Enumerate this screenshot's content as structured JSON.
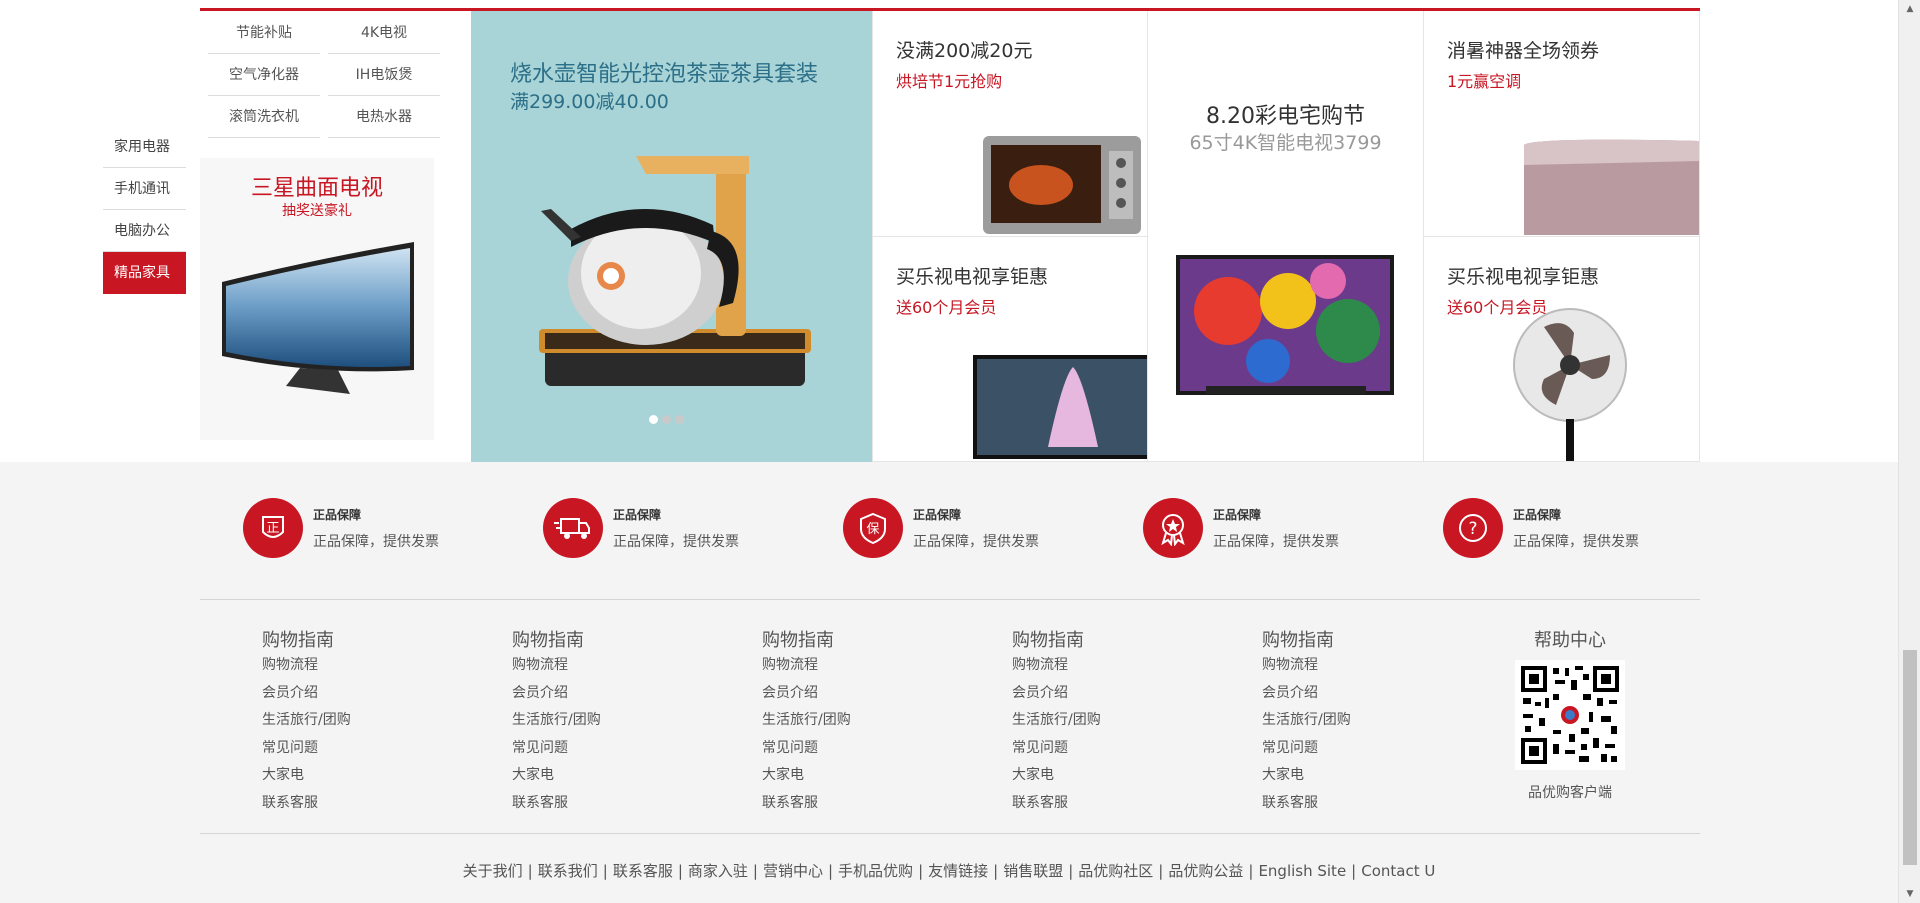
{
  "floor_tabs": [
    "家用电器",
    "手机通讯",
    "电脑办公",
    "精品家具"
  ],
  "categories": [
    "节能补贴",
    "4K电视",
    "空气净化器",
    "IH电饭煲",
    "滚筒洗衣机",
    "电热水器"
  ],
  "promo_tv": {
    "title": "三星曲面电视",
    "subtitle": "抽奖送豪礼"
  },
  "banner": {
    "title": "烧水壶智能光控泡茶壶茶具套装",
    "subtitle": "满299.00减40.00"
  },
  "cells": {
    "c1": {
      "title": "没满200减20元",
      "subtitle": "烘培节1元抢购"
    },
    "c2": {
      "title": "8.20彩电宅购节",
      "subtitle": "65寸4K智能电视3799"
    },
    "c3": {
      "title": "消暑神器全场领券",
      "subtitle": "1元赢空调"
    },
    "c4": {
      "title": "买乐视电视享钜惠",
      "subtitle": "送60个月会员"
    },
    "c5": {
      "title": "买乐视电视享钜惠",
      "subtitle": "送60个月会员"
    }
  },
  "services": [
    {
      "icon": "zheng-icon",
      "title": "正品保障",
      "desc": "正品保障，提供发票"
    },
    {
      "icon": "delivery-truck-icon",
      "title": "正品保障",
      "desc": "正品保障，提供发票"
    },
    {
      "icon": "bao-shield-icon",
      "title": "正品保障",
      "desc": "正品保障，提供发票"
    },
    {
      "icon": "medal-icon",
      "title": "正品保障",
      "desc": "正品保障，提供发票"
    },
    {
      "icon": "question-icon",
      "title": "正品保障",
      "desc": "正品保障，提供发票"
    }
  ],
  "footer_columns": [
    {
      "title": "购物指南",
      "links": [
        "购物流程",
        "会员介绍",
        "生活旅行/团购",
        "常见问题",
        "大家电",
        "联系客服"
      ]
    },
    {
      "title": "购物指南",
      "links": [
        "购物流程",
        "会员介绍",
        "生活旅行/团购",
        "常见问题",
        "大家电",
        "联系客服"
      ]
    },
    {
      "title": "购物指南",
      "links": [
        "购物流程",
        "会员介绍",
        "生活旅行/团购",
        "常见问题",
        "大家电",
        "联系客服"
      ]
    },
    {
      "title": "购物指南",
      "links": [
        "购物流程",
        "会员介绍",
        "生活旅行/团购",
        "常见问题",
        "大家电",
        "联系客服"
      ]
    },
    {
      "title": "购物指南",
      "links": [
        "购物流程",
        "会员介绍",
        "生活旅行/团购",
        "常见问题",
        "大家电",
        "联系客服"
      ]
    }
  ],
  "help": {
    "title": "帮助中心",
    "caption": "品优购客户端"
  },
  "bottom_links": [
    "关于我们",
    "联系我们",
    "联系客服",
    "商家入驻",
    "营销中心",
    "手机品优购",
    "友情链接",
    "销售联盟",
    "品优购社区",
    "品优购公益",
    "English Site",
    "Contact U"
  ],
  "colors": {
    "brand_red": "#c81623",
    "banner_bg": "#a9d4d7",
    "footer_bg": "#f4f4f4"
  }
}
